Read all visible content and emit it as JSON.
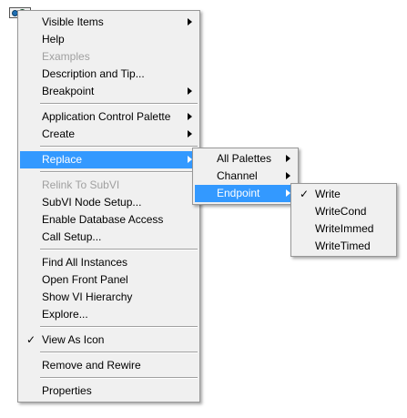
{
  "main_menu": {
    "items": [
      {
        "label": "Visible Items",
        "submenu": true
      },
      {
        "label": "Help"
      },
      {
        "label": "Examples",
        "disabled": true
      },
      {
        "label": "Description and Tip..."
      },
      {
        "label": "Breakpoint",
        "submenu": true
      },
      {
        "label": "Application Control Palette",
        "submenu": true
      },
      {
        "label": "Create",
        "submenu": true
      },
      {
        "label": "Replace",
        "submenu": true,
        "highlighted": true
      },
      {
        "label": "Relink To SubVI",
        "disabled": true
      },
      {
        "label": "SubVI Node Setup..."
      },
      {
        "label": "Enable Database Access"
      },
      {
        "label": "Call Setup..."
      },
      {
        "label": "Find All Instances"
      },
      {
        "label": "Open Front Panel"
      },
      {
        "label": "Show VI Hierarchy"
      },
      {
        "label": "Explore..."
      },
      {
        "label": "View As Icon",
        "checked": true
      },
      {
        "label": "Remove and Rewire"
      },
      {
        "label": "Properties"
      }
    ]
  },
  "replace_menu": {
    "items": [
      {
        "label": "All Palettes",
        "submenu": true
      },
      {
        "label": "Channel",
        "submenu": true
      },
      {
        "label": "Endpoint",
        "submenu": true,
        "highlighted": true
      }
    ]
  },
  "endpoint_menu": {
    "items": [
      {
        "label": "Write",
        "checked": true
      },
      {
        "label": "WriteCond"
      },
      {
        "label": "WriteImmed"
      },
      {
        "label": "WriteTimed"
      }
    ]
  },
  "check_glyph": "✓",
  "colors": {
    "highlight": "#3399ff",
    "menu_bg": "#f0f0f0",
    "disabled_text": "#a0a0a0",
    "border": "#979797"
  }
}
